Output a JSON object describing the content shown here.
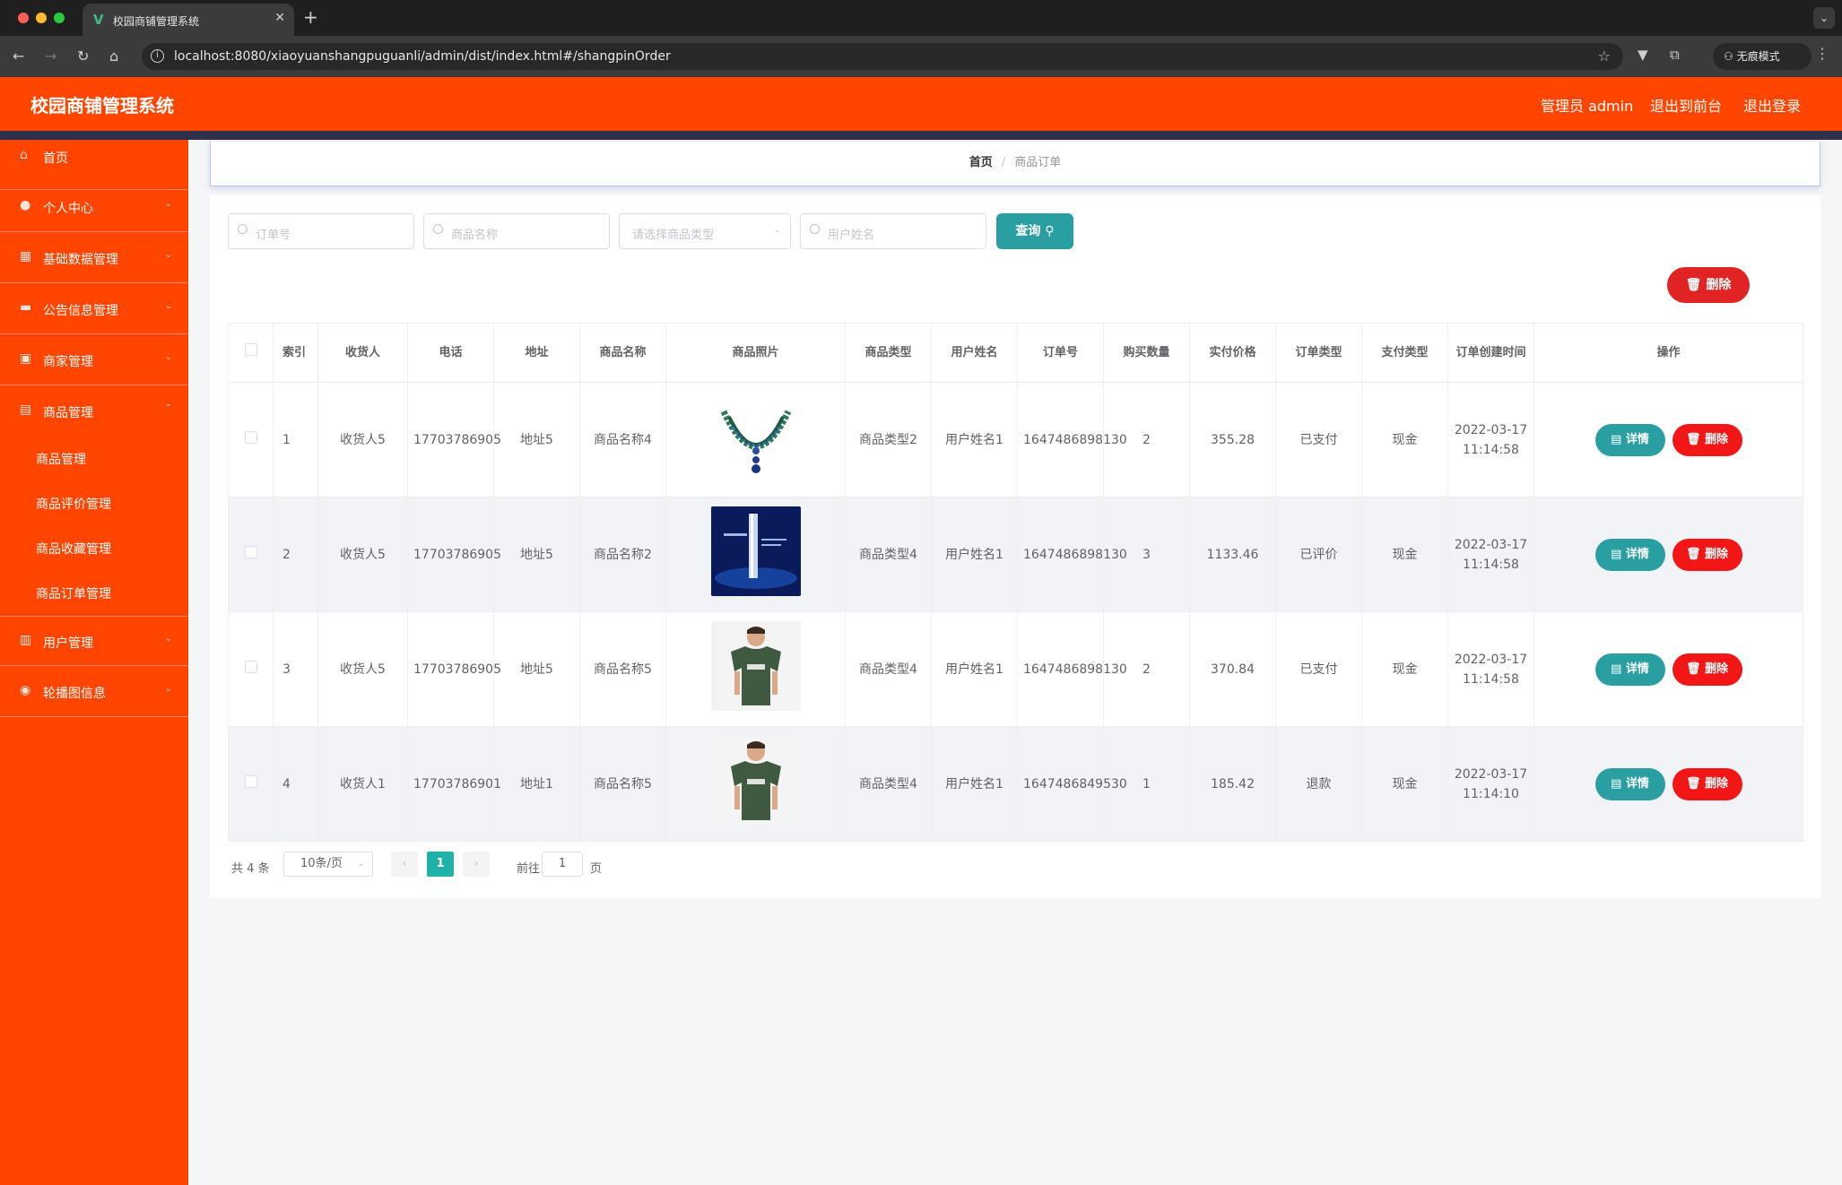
{
  "browser": {
    "tab_title": "校园商铺管理系统",
    "url": "localhost:8080/xiaoyuanshangpuguanli/admin/dist/index.html#/shangpinOrder",
    "incognito_label": "无痕模式"
  },
  "header": {
    "title": "校园商铺管理系统",
    "admin_label": "管理员 admin",
    "back_front_label": "退出到前台",
    "logout_label": "退出登录"
  },
  "sidebar": {
    "items": [
      {
        "label": "首页",
        "icon": "home-icon"
      },
      {
        "label": "个人中心",
        "icon": "user-icon"
      },
      {
        "label": "基础数据管理",
        "icon": "grid-icon"
      },
      {
        "label": "公告信息管理",
        "icon": "video-icon"
      },
      {
        "label": "商家管理",
        "icon": "shop-icon"
      },
      {
        "label": "商品管理",
        "icon": "bag-icon"
      },
      {
        "label": "用户管理",
        "icon": "chart-icon"
      },
      {
        "label": "轮播图信息",
        "icon": "location-icon"
      }
    ],
    "submenu": [
      "商品管理",
      "商品评价管理",
      "商品收藏管理",
      "商品订单管理"
    ]
  },
  "breadcrumb": {
    "home": "首页",
    "current": "商品订单"
  },
  "search": {
    "order_no_placeholder": "订单号",
    "product_name_placeholder": "商品名称",
    "product_type_placeholder": "请选择商品类型",
    "user_name_placeholder": "用户姓名",
    "search_label": "查询"
  },
  "bulk_delete_label": "删除",
  "table": {
    "headers": [
      "索引",
      "收货人",
      "电话",
      "地址",
      "商品名称",
      "商品照片",
      "商品类型",
      "用户姓名",
      "订单号",
      "购买数量",
      "实付价格",
      "订单类型",
      "支付类型",
      "订单创建时间",
      "操作"
    ],
    "detail_label": "详情",
    "delete_label": "删除",
    "rows": [
      {
        "index": "1",
        "receiver": "收货人5",
        "phone": "17703786905",
        "address": "地址5",
        "product_name": "商品名称4",
        "photo": "necklace",
        "product_type": "商品类型2",
        "user_name": "用户姓名1",
        "order_no": "1647486898130",
        "quantity": "2",
        "price": "355.28",
        "order_type": "已支付",
        "pay_type": "现金",
        "created": "2022-03-17 11:14:58"
      },
      {
        "index": "2",
        "receiver": "收货人5",
        "phone": "17703786905",
        "address": "地址5",
        "product_name": "商品名称2",
        "photo": "blue-ad",
        "product_type": "商品类型4",
        "user_name": "用户姓名1",
        "order_no": "1647486898130",
        "quantity": "3",
        "price": "1133.46",
        "order_type": "已评价",
        "pay_type": "现金",
        "created": "2022-03-17 11:14:58"
      },
      {
        "index": "3",
        "receiver": "收货人5",
        "phone": "17703786905",
        "address": "地址5",
        "product_name": "商品名称5",
        "photo": "tshirt",
        "product_type": "商品类型4",
        "user_name": "用户姓名1",
        "order_no": "1647486898130",
        "quantity": "2",
        "price": "370.84",
        "order_type": "已支付",
        "pay_type": "现金",
        "created": "2022-03-17 11:14:58"
      },
      {
        "index": "4",
        "receiver": "收货人1",
        "phone": "17703786901",
        "address": "地址1",
        "product_name": "商品名称5",
        "photo": "tshirt",
        "product_type": "商品类型4",
        "user_name": "用户姓名1",
        "order_no": "1647486849530",
        "quantity": "1",
        "price": "185.42",
        "order_type": "退款",
        "pay_type": "现金",
        "created": "2022-03-17 11:14:10"
      }
    ]
  },
  "pagination": {
    "total": "共 4 条",
    "page_size": "10条/页",
    "current_page": "1",
    "goto_label": "前往",
    "goto_value": "1",
    "page_unit": "页"
  },
  "colors": {
    "brand": "#ff4500",
    "teal": "#2a9fa1",
    "danger": "#f31616"
  }
}
